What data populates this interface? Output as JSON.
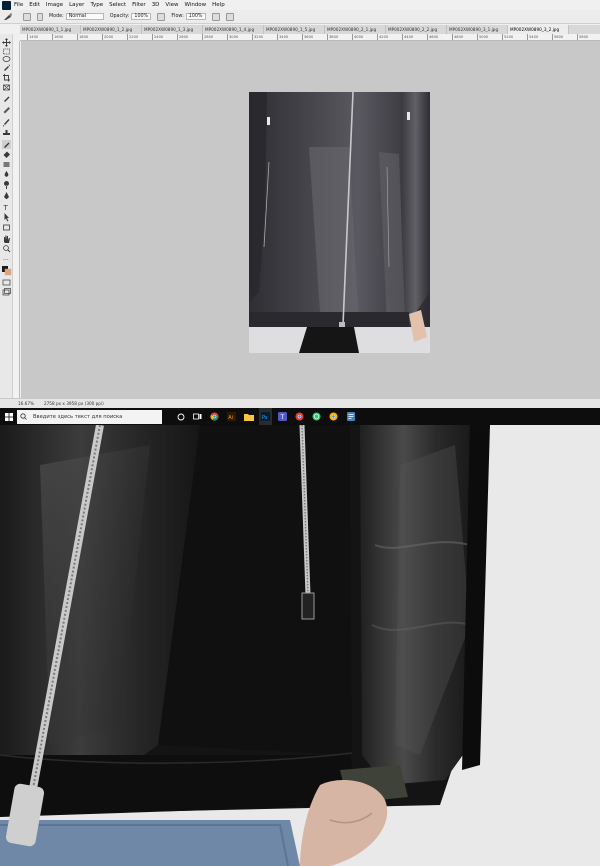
{
  "menu": {
    "items": [
      "File",
      "Edit",
      "Image",
      "Layer",
      "Type",
      "Select",
      "Filter",
      "3D",
      "View",
      "Window",
      "Help"
    ]
  },
  "options": {
    "mode_label": "Mode:",
    "mode_value": "Normal",
    "opacity_label": "Opacity:",
    "opacity_value": "100%",
    "flow_label": "Flow:",
    "flow_value": "100%"
  },
  "tabs": [
    {
      "label": "MP002XW0890_1_1.jpg",
      "active": false
    },
    {
      "label": "MP002XW0890_1_2.jpg",
      "active": false
    },
    {
      "label": "MP002XW0890_1_3.jpg",
      "active": false
    },
    {
      "label": "MP002XW0890_1_4.jpg",
      "active": false
    },
    {
      "label": "MP002XW0890_1_5.jpg",
      "active": false
    },
    {
      "label": "MP002XW0890_2_1.jpg",
      "active": false
    },
    {
      "label": "MP002XW0890_2_2.jpg",
      "active": false
    },
    {
      "label": "MP002XW0890_3_1.jpg",
      "active": false
    },
    {
      "label": "MP002XW0890_3_2.jpg",
      "active": true
    }
  ],
  "ruler": {
    "labels": [
      "1400",
      "1600",
      "1800",
      "2000",
      "2200",
      "2400",
      "2600",
      "2800",
      "3000",
      "3200",
      "3400",
      "3600",
      "3800",
      "4000",
      "4200",
      "4400",
      "4600",
      "4800",
      "5000",
      "5200",
      "5400",
      "5600",
      "5800"
    ]
  },
  "status": {
    "zoom": "16.67%",
    "doc_info": "2758 px x 3958 px (300 ppi)"
  },
  "taskbar": {
    "search_placeholder": "Введите здесь текст для поиска",
    "apps": [
      "cortana-icon",
      "task-view-icon",
      "chrome-icon",
      "illustrator-icon",
      "explorer-icon",
      "photoshop-icon",
      "teams-icon",
      "chrome-alt-icon",
      "whatsapp-icon",
      "chrome-icon-2",
      "notes-icon"
    ]
  },
  "colors": {
    "ps_bg": "#f0f0f0",
    "canvas": "#c8c8c8",
    "taskbar": "#0d0d0d",
    "jacket_dark": "#3b3a3f",
    "jacket_black": "#141414"
  }
}
